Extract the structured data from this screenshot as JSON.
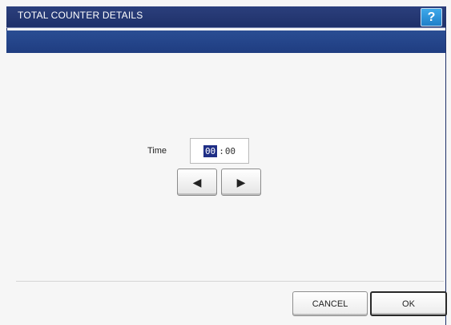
{
  "window": {
    "title": "TOTAL COUNTER DETAILS",
    "help_label": "?"
  },
  "time": {
    "label": "Time",
    "hours": "00",
    "separator": ":",
    "minutes": "00"
  },
  "controls": {
    "left_arrow": "◀",
    "right_arrow": "▶"
  },
  "actions": {
    "cancel_label": "CANCEL",
    "ok_label": "OK"
  },
  "colors": {
    "titlebar": "#1f316a",
    "subbar": "#1f3d81",
    "help_button": "#2b96de",
    "selection": "#1f2f86"
  },
  "icons": [
    "help-icon",
    "left-arrow-icon",
    "right-arrow-icon"
  ]
}
